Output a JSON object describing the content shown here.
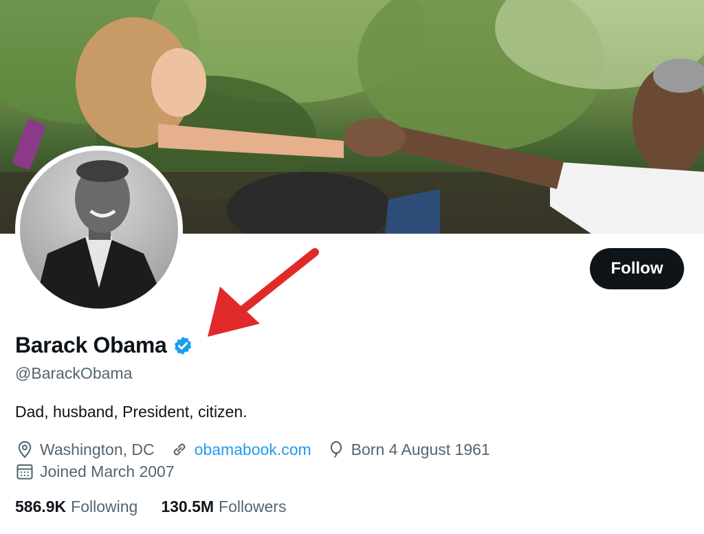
{
  "profile": {
    "name": "Barack Obama",
    "handle": "@BarackObama",
    "bio": "Dad, husband, President, citizen.",
    "location": "Washington, DC",
    "website": "obamabook.com",
    "birthday": "Born 4 August 1961",
    "joined": "Joined March 2007",
    "following_count": "586.9K",
    "following_label": "Following",
    "followers_count": "130.5M",
    "followers_label": "Followers"
  },
  "actions": {
    "follow_label": "Follow"
  },
  "icons": {
    "location": "location-pin-icon",
    "link": "link-icon",
    "birthday": "balloon-icon",
    "joined": "calendar-icon",
    "verified": "verified-badge-icon"
  },
  "colors": {
    "verified": "#1d9bf0",
    "link": "#1d9bf0",
    "annotation_arrow": "#e02a2a",
    "follow_button": "#0f1419"
  }
}
